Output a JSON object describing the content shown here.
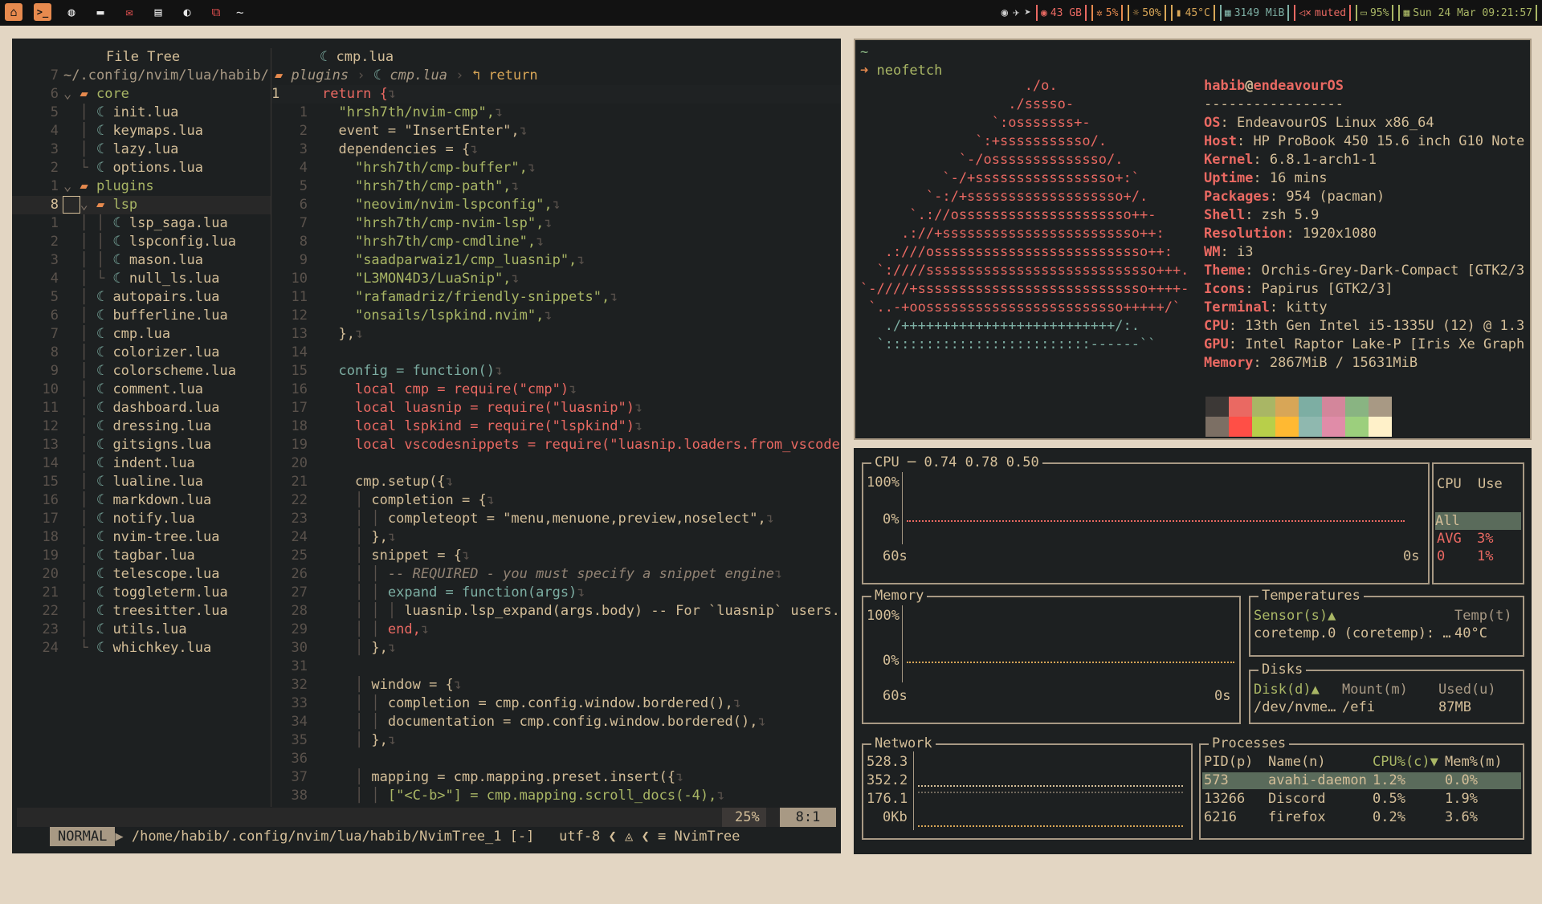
{
  "topbar": {
    "workspace": "~",
    "disk": "43 GB",
    "cpu": "5%",
    "brightness": "50%",
    "temp": "45°C",
    "mem": "3149 MiB",
    "volume": "muted",
    "battery": "95%",
    "datetime": "Sun 24 Mar 09:21:57"
  },
  "tree": {
    "header": "File Tree",
    "rows": [
      {
        "ln": "7",
        "text": "~/.config/nvim/lua/habib/"
      },
      {
        "ln": "6",
        "text": "core"
      },
      {
        "ln": "5",
        "text": "init.lua"
      },
      {
        "ln": "4",
        "text": "keymaps.lua"
      },
      {
        "ln": "3",
        "text": "lazy.lua"
      },
      {
        "ln": "2",
        "text": "options.lua"
      },
      {
        "ln": "1",
        "text": "plugins"
      },
      {
        "ln": "8",
        "text": "lsp"
      },
      {
        "ln": "1",
        "text": "lsp_saga.lua"
      },
      {
        "ln": "2",
        "text": "lspconfig.lua"
      },
      {
        "ln": "3",
        "text": "mason.lua"
      },
      {
        "ln": "4",
        "text": "null_ls.lua"
      },
      {
        "ln": "5",
        "text": "autopairs.lua"
      },
      {
        "ln": "6",
        "text": "bufferline.lua"
      },
      {
        "ln": "7",
        "text": "cmp.lua"
      },
      {
        "ln": "8",
        "text": "colorizer.lua"
      },
      {
        "ln": "9",
        "text": "colorscheme.lua"
      },
      {
        "ln": "10",
        "text": "comment.lua"
      },
      {
        "ln": "11",
        "text": "dashboard.lua"
      },
      {
        "ln": "12",
        "text": "dressing.lua"
      },
      {
        "ln": "13",
        "text": "gitsigns.lua"
      },
      {
        "ln": "14",
        "text": "indent.lua"
      },
      {
        "ln": "15",
        "text": "lualine.lua"
      },
      {
        "ln": "16",
        "text": "markdown.lua"
      },
      {
        "ln": "17",
        "text": "notify.lua"
      },
      {
        "ln": "18",
        "text": "nvim-tree.lua"
      },
      {
        "ln": "19",
        "text": "tagbar.lua"
      },
      {
        "ln": "20",
        "text": "telescope.lua"
      },
      {
        "ln": "21",
        "text": "toggleterm.lua"
      },
      {
        "ln": "22",
        "text": "treesitter.lua"
      },
      {
        "ln": "23",
        "text": "utils.lua"
      },
      {
        "ln": "24",
        "text": "whichkey.lua"
      }
    ]
  },
  "editor": {
    "tab": "cmp.lua",
    "breadcrumb": {
      "a": "plugins",
      "b": "cmp.lua",
      "c": "return"
    },
    "lines": [
      {
        "ln": "1",
        "text": "return {"
      },
      {
        "ln": "1",
        "text": "\"hrsh7th/nvim-cmp\","
      },
      {
        "ln": "2",
        "text": "event = \"InsertEnter\","
      },
      {
        "ln": "3",
        "text": "dependencies = {"
      },
      {
        "ln": "4",
        "text": "\"hrsh7th/cmp-buffer\","
      },
      {
        "ln": "5",
        "text": "\"hrsh7th/cmp-path\","
      },
      {
        "ln": "6",
        "text": "\"neovim/nvim-lspconfig\","
      },
      {
        "ln": "7",
        "text": "\"hrsh7th/cmp-nvim-lsp\","
      },
      {
        "ln": "8",
        "text": "\"hrsh7th/cmp-cmdline\","
      },
      {
        "ln": "9",
        "text": "\"saadparwaiz1/cmp_luasnip\","
      },
      {
        "ln": "10",
        "text": "\"L3MON4D3/LuaSnip\","
      },
      {
        "ln": "11",
        "text": "\"rafamadriz/friendly-snippets\","
      },
      {
        "ln": "12",
        "text": "\"onsails/lspkind.nvim\","
      },
      {
        "ln": "13",
        "text": "},"
      },
      {
        "ln": "14",
        "text": ""
      },
      {
        "ln": "15",
        "text": "config = function()"
      },
      {
        "ln": "16",
        "text": "local cmp = require(\"cmp\")"
      },
      {
        "ln": "17",
        "text": "local luasnip = require(\"luasnip\")"
      },
      {
        "ln": "18",
        "text": "local lspkind = require(\"lspkind\")"
      },
      {
        "ln": "19",
        "text": "local vscodesnippets = require(\"luasnip.loaders.from_vscode\""
      },
      {
        "ln": "20",
        "text": ""
      },
      {
        "ln": "21",
        "text": "cmp.setup({"
      },
      {
        "ln": "22",
        "text": "completion = {"
      },
      {
        "ln": "23",
        "text": "completeopt = \"menu,menuone,preview,noselect\","
      },
      {
        "ln": "24",
        "text": "},"
      },
      {
        "ln": "25",
        "text": "snippet = {"
      },
      {
        "ln": "26",
        "text": "-- REQUIRED - you must specify a snippet engine"
      },
      {
        "ln": "27",
        "text": "expand = function(args)"
      },
      {
        "ln": "28",
        "text": "luasnip.lsp_expand(args.body) -- For `luasnip` users."
      },
      {
        "ln": "29",
        "text": "end,"
      },
      {
        "ln": "30",
        "text": "},"
      },
      {
        "ln": "31",
        "text": ""
      },
      {
        "ln": "32",
        "text": "window = {"
      },
      {
        "ln": "33",
        "text": "completion = cmp.config.window.bordered(),"
      },
      {
        "ln": "34",
        "text": "documentation = cmp.config.window.bordered(),"
      },
      {
        "ln": "35",
        "text": "},"
      },
      {
        "ln": "36",
        "text": ""
      },
      {
        "ln": "37",
        "text": "mapping = cmp.mapping.preset.insert({"
      },
      {
        "ln": "38",
        "text": "[\"<C-b>\"] = cmp.mapping.scroll_docs(-4),"
      }
    ]
  },
  "statusline": {
    "mode": "NORMAL",
    "path": "/home/habib/.config/nvim/lua/habib/NvimTree_1 [-]",
    "encoding": "utf-8",
    "filetype": "NvimTree",
    "percent": "25%",
    "position": "8:1"
  },
  "neofetch": {
    "prompt_tilde": "~",
    "command": "neofetch",
    "user": "habib",
    "host": "endeavourOS",
    "divider": "-----------------",
    "info": [
      {
        "k": "OS",
        "v": "EndeavourOS Linux x86_64"
      },
      {
        "k": "Host",
        "v": "HP ProBook 450 15.6 inch G10 Note"
      },
      {
        "k": "Kernel",
        "v": "6.8.1-arch1-1"
      },
      {
        "k": "Uptime",
        "v": "16 mins"
      },
      {
        "k": "Packages",
        "v": "954 (pacman)"
      },
      {
        "k": "Shell",
        "v": "zsh 5.9"
      },
      {
        "k": "Resolution",
        "v": "1920x1080"
      },
      {
        "k": "WM",
        "v": "i3"
      },
      {
        "k": "Theme",
        "v": "Orchis-Grey-Dark-Compact [GTK2/3"
      },
      {
        "k": "Icons",
        "v": "Papirus [GTK2/3]"
      },
      {
        "k": "Terminal",
        "v": "kitty"
      },
      {
        "k": "CPU",
        "v": "13th Gen Intel i5-1335U (12) @ 1.3"
      },
      {
        "k": "GPU",
        "v": "Intel Raptor Lake-P [Iris Xe Graph"
      },
      {
        "k": "Memory",
        "v": "2867MiB / 15631MiB"
      }
    ],
    "logo": [
      "                    ./o.",
      "                  ./sssso-",
      "                `:osssssss+-",
      "              `:+sssssssssso/.",
      "            `-/ossssssssssssso/.",
      "          `-/+sssssssssssssssso+:`",
      "        `-:/+sssssssssssssssssso+/.",
      "      `.://osssssssssssssssssssso++-",
      "     .://+ssssssssssssssssssssssso++:",
      "   .:///ossssssssssssssssssssssssso++:",
      "  `:////ssssssssssssssssssssssssssso+++.",
      "`-////+ssssssssssssssssssssssssssso++++-",
      " `..-+oossssssssssssssssssssssso+++++/`",
      "   ./++++++++++++++++++++++++++/:.",
      "  `:::::::::::::::::::::::::------``"
    ],
    "palette_top": [
      "#3c3836",
      "#ea6962",
      "#a9b665",
      "#d8a657",
      "#7daea3",
      "#d3869b",
      "#89b482",
      "#a89984"
    ],
    "palette_bottom": [
      "#7c6f64",
      "#ff4f46",
      "#b8cf4a",
      "#ffb932",
      "#8fb8af",
      "#e08ca8",
      "#9ccf7d",
      "#fff1c9"
    ]
  },
  "btop": {
    "cpu": {
      "title": "CPU",
      "load": "0.74 0.78 0.50",
      "top": "100%",
      "zero": "0%",
      "time_left": "60s",
      "time_right": "0s"
    },
    "cpu_side": {
      "col1": "CPU",
      "col2": "Use",
      "all": "All",
      "avg_label": "AVG",
      "avg_val": "3%",
      "core_label": "0",
      "core_val": "1%"
    },
    "memory": {
      "title": "Memory",
      "top": "100%",
      "zero": "0%",
      "time_left": "60s",
      "time_right": "0s"
    },
    "temps": {
      "title": "Temperatures",
      "sensor_h": "Sensor(s)▲",
      "temp_h": "Temp(t)",
      "sensor": "coretemp.0 (coretemp): …",
      "temp": "40°C"
    },
    "disks": {
      "title": "Disks",
      "disk_h": "Disk(d)▲",
      "mount_h": "Mount(m)",
      "used_h": "Used(u)",
      "disk": "/dev/nvme…",
      "mount": "/efi",
      "used": "87MB"
    },
    "network": {
      "title": "Network",
      "v1": "528.3",
      "v2": "352.2",
      "v3": "176.1",
      "v4": "0Kb"
    },
    "processes": {
      "title": "Processes",
      "headers": {
        "pid": "PID(p)",
        "name": "Name(n)",
        "cpu": "CPU%(c)▼",
        "mem": "Mem%(m)"
      },
      "rows": [
        {
          "pid": "573",
          "name": "avahi-daemon",
          "cpu": "1.2%",
          "mem": "0.0%"
        },
        {
          "pid": "13266",
          "name": "Discord",
          "cpu": "0.5%",
          "mem": "1.9%"
        },
        {
          "pid": "6216",
          "name": "firefox",
          "cpu": "0.2%",
          "mem": "3.6%"
        }
      ]
    }
  },
  "colors": {
    "accent": "#e78a4e",
    "red": "#ea6962",
    "green": "#a9b665",
    "bg": "#1d2021",
    "fg": "#d4be98"
  }
}
